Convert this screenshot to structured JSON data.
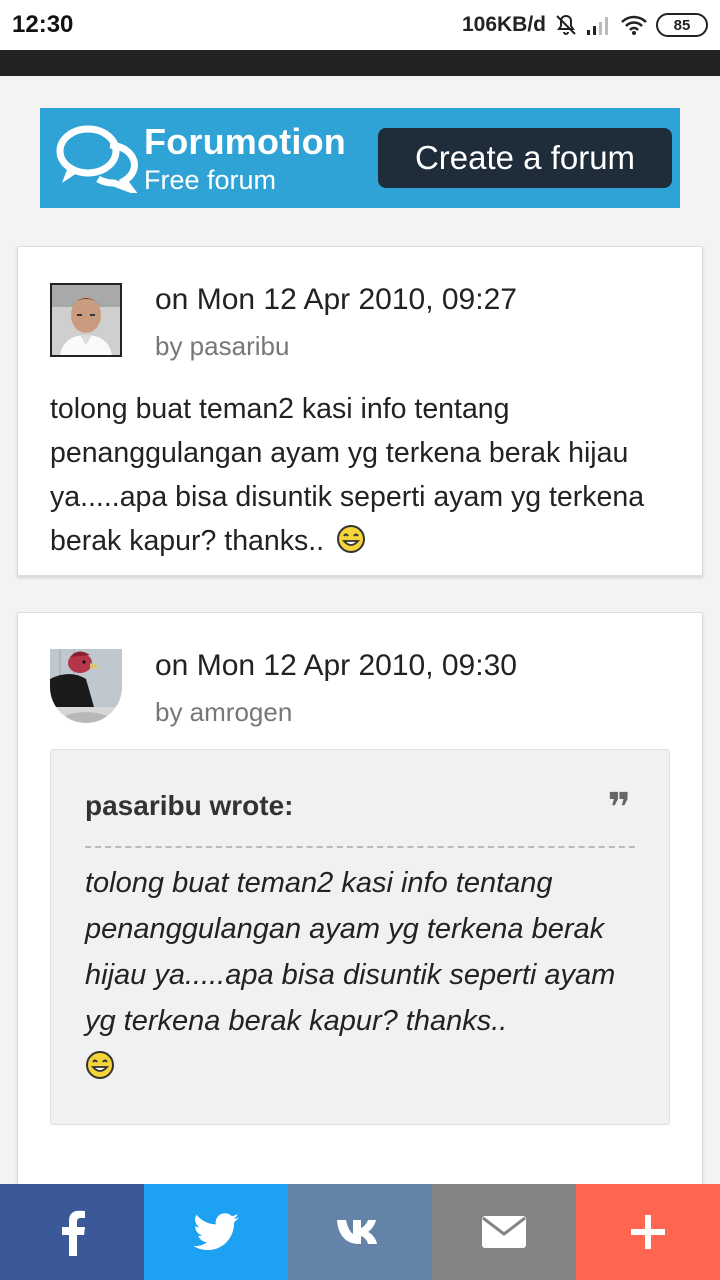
{
  "status_bar": {
    "time": "12:30",
    "network_speed": "106KB/d",
    "battery": "85"
  },
  "banner": {
    "brand": "Forumotion",
    "subtitle": "Free forum",
    "cta": "Create a forum",
    "color": "#2fa3d6"
  },
  "posts": [
    {
      "date": "on Mon 12 Apr 2010, 09:27",
      "author": "by pasaribu",
      "body": "tolong buat teman2 kasi info tentang penanggulangan ayam yg terkena berak hijau ya.....apa bisa disuntik seperti ayam yg terkena berak kapur? thanks..",
      "avatar_icon": "avatar-man-icon"
    },
    {
      "date": "on Mon 12 Apr 2010, 09:30",
      "author": "by amrogen",
      "avatar_icon": "avatar-rooster-icon",
      "quote": {
        "header": "pasaribu wrote:",
        "text": "tolong buat teman2 kasi info tentang penanggulangan ayam yg terkena berak hijau ya.....apa bisa disuntik seperti ayam yg terkena berak kapur? thanks.."
      }
    }
  ],
  "share_bar": [
    {
      "icon": "facebook-icon",
      "color": "#3b5998"
    },
    {
      "icon": "twitter-icon",
      "color": "#1da1f2"
    },
    {
      "icon": "vk-icon",
      "color": "#6383a8"
    },
    {
      "icon": "mail-icon",
      "color": "#848484"
    },
    {
      "icon": "plus-icon",
      "color": "#ff6550"
    }
  ]
}
